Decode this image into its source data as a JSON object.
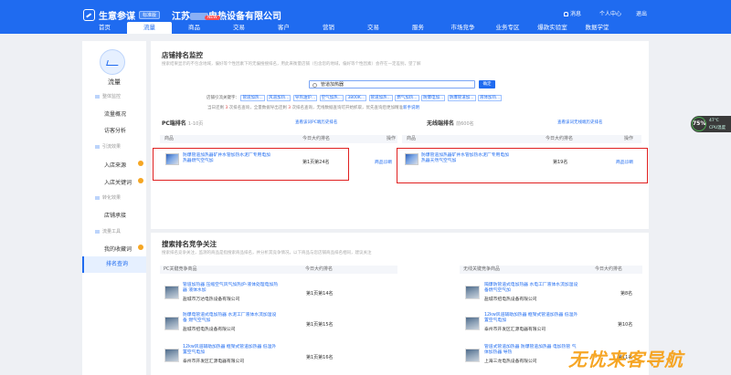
{
  "header": {
    "brand": "生意参谋",
    "brand_tag": "标准版",
    "shop_prefix": "江苏",
    "shop_suffix": "电热设备有限公司",
    "messages": "消息",
    "user_center": "个人中心",
    "logout": "退出",
    "new_badge": "NEW",
    "nav": [
      "首页",
      "流量",
      "商品",
      "交易",
      "客户",
      "营销",
      "交易",
      "服务",
      "市场竞争",
      "业务专区",
      "爆款实验室",
      "数据学堂"
    ]
  },
  "sidebar": {
    "title": "流量",
    "groups": [
      {
        "label": "整体监控",
        "items": [
          {
            "label": "流量概况",
            "dot": false
          },
          {
            "label": "访客分析",
            "dot": false
          }
        ]
      },
      {
        "label": "引流效果",
        "items": [
          {
            "label": "入店来源",
            "dot": true
          },
          {
            "label": "入店关键词",
            "dot": true
          }
        ]
      },
      {
        "label": "转化效果",
        "items": [
          {
            "label": "店铺承接",
            "dot": false
          }
        ]
      },
      {
        "label": "流量工具",
        "items": [
          {
            "label": "我的收藏词",
            "dot": true
          },
          {
            "label": "排名查询",
            "dot": false,
            "active": true
          }
        ]
      }
    ]
  },
  "monitor": {
    "title": "店铺排名监控",
    "desc": "搜索结果显示的不包含地域，偏好等个性因素下的无偏搜搜排名，用此来衡量店铺（包含您的地域，偏好等个性因素）会存在一定差别，望了解",
    "search_value": "管道加热器",
    "search_button": "确定",
    "kw_label": "店铺引流关键字：",
    "keywords": [
      "管道加热...",
      "风道加热...",
      "导热油炉...",
      "空气加热...",
      "3800K...",
      "管道加热...",
      "燃气加热...",
      "防爆电加...",
      "防爆管道加...",
      "液体加热..."
    ],
    "hint_pre": "当日还剩",
    "hint_count": "3",
    "hint_mid": "次排名查询，全量数据导出还剩",
    "hint_count2": "3",
    "hint_post": "次排名查询，无线数据查询可开始抓取，优先查询后更加精准",
    "hint_link": "新手说明"
  },
  "pc": {
    "title": "PC端排名",
    "range": "1-10页",
    "history_link": "查看该词PC端历史排名",
    "col_product": "商品",
    "col_rank": "今日大约排名",
    "col_op": "操作",
    "product": "防爆管道加热器矿井水管加热水泥厂专用电加热器燃气空气加",
    "rank": "第1页第24名",
    "op": "商品诊断"
  },
  "wireless": {
    "title": "无线端排名",
    "range": "前600名",
    "history_link": "查看该词无线端历史排名",
    "col_product": "商品",
    "col_rank": "今日大约排名",
    "col_op": "操作",
    "product": "防爆管道加热器矿井水管加热水泥厂专用电加热器天然气空气加",
    "rank": "第19名",
    "op": "商品诊断"
  },
  "competition": {
    "title": "搜索排名竞争关注",
    "desc": "搜索排名竞争关注，监测的商品是指搜索商品排名，并分析其竞争情况，以下商品与您店铺商品排名相同，建议关注",
    "pc_col": "PC关键竞争商品",
    "wireless_col": "无线关键竞争商品",
    "rank_col": "今日大约排名",
    "pc_rows": [
      {
        "name": "管道加热器 压缩空气风气加热炉-液体处理电加热器 液体水加",
        "shop": "盐城市万达电热设备有限公司",
        "rank": "第1页第14名"
      },
      {
        "name": "防爆电管道式电加热器 水泥工厂液体水流加温设备 燃气空气加",
        "shop": "盐城市招电热设备有限公司",
        "rank": "第1页第15名"
      },
      {
        "name": "12kw风道辅助加热器 框架式管道加热器 低温外置空气电加",
        "shop": "泰州市开发区汇源电器有限公司",
        "rank": "第1页第16名"
      }
    ],
    "wireless_rows": [
      {
        "name": "隔爆防管道式电加热器 水电工厂液体水流加温设备燃气空气加",
        "shop": "盐城市招电热设备有限公司",
        "rank": "第8名"
      },
      {
        "name": "12kw风道辅助加热器 框架式管道加热器 低温外置空气电加",
        "shop": "泰州市开发区汇源电器有限公司",
        "rank": "第10名"
      },
      {
        "name": "管道式管道加热器 防爆管道加热器 电加热管 气体加热器 导热",
        "shop": "上海三龙电热设备有限公司",
        "rank": "第11名"
      }
    ]
  },
  "widget": {
    "percent": "75%",
    "temp": "47℃",
    "label": "CPU温度"
  },
  "watermark": "无忧来客导航"
}
